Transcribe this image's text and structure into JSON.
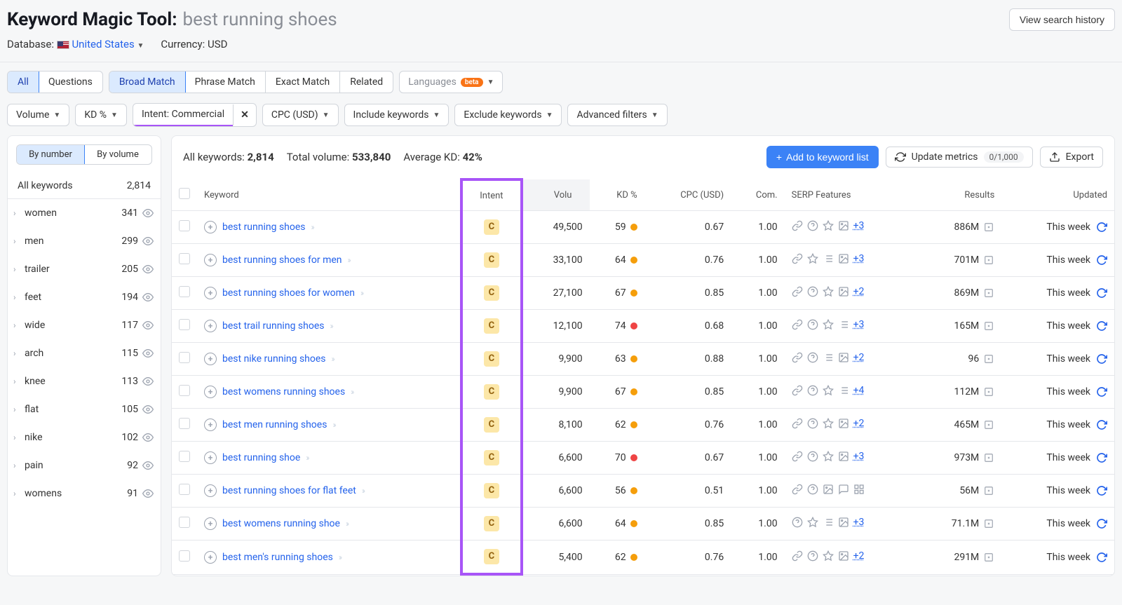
{
  "header": {
    "tool_name": "Keyword Magic Tool:",
    "keyword": "best running shoes",
    "history_btn": "View search history",
    "database_label": "Database:",
    "database_value": "United States",
    "currency_label": "Currency:",
    "currency_value": "USD"
  },
  "tabs1": {
    "all": "All",
    "questions": "Questions"
  },
  "tabs2": {
    "broad": "Broad Match",
    "phrase": "Phrase Match",
    "exact": "Exact Match",
    "related": "Related"
  },
  "lang": {
    "label": "Languages",
    "badge": "beta"
  },
  "filters": {
    "volume": "Volume",
    "kd": "KD %",
    "intent": "Intent: Commercial",
    "cpc": "CPC (USD)",
    "include": "Include keywords",
    "exclude": "Exclude keywords",
    "advanced": "Advanced filters"
  },
  "sidebar": {
    "by_number": "By number",
    "by_volume": "By volume",
    "all_label": "All keywords",
    "all_count": "2,814",
    "items": [
      {
        "name": "women",
        "count": "341"
      },
      {
        "name": "men",
        "count": "299"
      },
      {
        "name": "trailer",
        "count": "205"
      },
      {
        "name": "feet",
        "count": "194"
      },
      {
        "name": "wide",
        "count": "117"
      },
      {
        "name": "arch",
        "count": "115"
      },
      {
        "name": "knee",
        "count": "113"
      },
      {
        "name": "flat",
        "count": "105"
      },
      {
        "name": "nike",
        "count": "102"
      },
      {
        "name": "pain",
        "count": "92"
      },
      {
        "name": "womens",
        "count": "91"
      }
    ]
  },
  "stats": {
    "all_kw_label": "All keywords:",
    "all_kw": "2,814",
    "total_vol_label": "Total volume:",
    "total_vol": "533,840",
    "avg_kd_label": "Average KD:",
    "avg_kd": "42%"
  },
  "actions": {
    "add": "Add to keyword list",
    "update": "Update metrics",
    "update_count": "0/1,000",
    "export": "Export"
  },
  "columns": {
    "keyword": "Keyword",
    "intent": "Intent",
    "volume": "Volu",
    "kd": "KD %",
    "cpc": "CPC (USD)",
    "com": "Com.",
    "serp": "SERP Features",
    "results": "Results",
    "updated": "Updated"
  },
  "rows": [
    {
      "kw": "best running shoes",
      "intent": "C",
      "vol": "49,500",
      "kd": "59",
      "kdc": "#f59e0b",
      "cpc": "0.67",
      "com": "1.00",
      "serp": [
        "link",
        "qmark",
        "star",
        "image"
      ],
      "more": "+3",
      "res": "886M",
      "upd": "This week"
    },
    {
      "kw": "best running shoes for men",
      "intent": "C",
      "vol": "33,100",
      "kd": "64",
      "kdc": "#f59e0b",
      "cpc": "0.76",
      "com": "1.00",
      "serp": [
        "link",
        "star",
        "list",
        "image"
      ],
      "more": "+3",
      "res": "701M",
      "upd": "This week"
    },
    {
      "kw": "best running shoes for women",
      "intent": "C",
      "vol": "27,100",
      "kd": "67",
      "kdc": "#f59e0b",
      "cpc": "0.85",
      "com": "1.00",
      "serp": [
        "link",
        "qmark",
        "star",
        "image"
      ],
      "more": "+2",
      "res": "869M",
      "upd": "This week"
    },
    {
      "kw": "best trail running shoes",
      "intent": "C",
      "vol": "12,100",
      "kd": "74",
      "kdc": "#ef4444",
      "cpc": "0.68",
      "com": "1.00",
      "serp": [
        "link",
        "qmark",
        "star",
        "list"
      ],
      "more": "+3",
      "res": "165M",
      "upd": "This week"
    },
    {
      "kw": "best nike running shoes",
      "intent": "C",
      "vol": "9,900",
      "kd": "63",
      "kdc": "#f59e0b",
      "cpc": "0.88",
      "com": "1.00",
      "serp": [
        "link",
        "qmark",
        "list",
        "image"
      ],
      "more": "+2",
      "res": "96",
      "upd": "This week"
    },
    {
      "kw": "best womens running shoes",
      "intent": "C",
      "vol": "9,900",
      "kd": "67",
      "kdc": "#f59e0b",
      "cpc": "0.85",
      "com": "1.00",
      "serp": [
        "link",
        "qmark",
        "star",
        "list"
      ],
      "more": "+4",
      "res": "112M",
      "upd": "This week"
    },
    {
      "kw": "best men running shoes",
      "intent": "C",
      "vol": "8,100",
      "kd": "62",
      "kdc": "#f59e0b",
      "cpc": "0.76",
      "com": "1.00",
      "serp": [
        "link",
        "qmark",
        "star",
        "image"
      ],
      "more": "+2",
      "res": "465M",
      "upd": "This week"
    },
    {
      "kw": "best running shoe",
      "intent": "C",
      "vol": "6,600",
      "kd": "70",
      "kdc": "#ef4444",
      "cpc": "0.67",
      "com": "1.00",
      "serp": [
        "link",
        "qmark",
        "star",
        "image"
      ],
      "more": "+3",
      "res": "973M",
      "upd": "This week"
    },
    {
      "kw": "best running shoes for flat feet",
      "intent": "C",
      "vol": "6,600",
      "kd": "56",
      "kdc": "#f59e0b",
      "cpc": "0.51",
      "com": "1.00",
      "serp": [
        "link",
        "qmark",
        "image",
        "chat",
        "grid"
      ],
      "more": "",
      "res": "56M",
      "upd": "This week"
    },
    {
      "kw": "best womens running shoe",
      "intent": "C",
      "vol": "6,600",
      "kd": "64",
      "kdc": "#f59e0b",
      "cpc": "0.85",
      "com": "1.00",
      "serp": [
        "qmark",
        "star",
        "list",
        "image"
      ],
      "more": "+3",
      "res": "71.1M",
      "upd": "This week"
    },
    {
      "kw": "best men's running shoes",
      "intent": "C",
      "vol": "5,400",
      "kd": "62",
      "kdc": "#f59e0b",
      "cpc": "0.76",
      "com": "1.00",
      "serp": [
        "link",
        "qmark",
        "star",
        "image"
      ],
      "more": "+2",
      "res": "291M",
      "upd": "This week"
    }
  ]
}
